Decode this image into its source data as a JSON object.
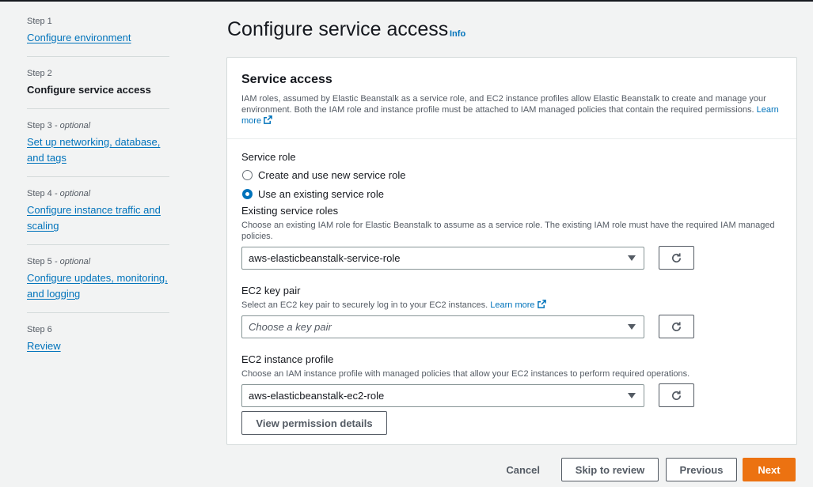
{
  "sidebar": {
    "steps": [
      {
        "num": "Step 1",
        "optional": "",
        "title": "Configure environment"
      },
      {
        "num": "Step 2",
        "optional": "",
        "title": "Configure service access"
      },
      {
        "num": "Step 3",
        "optional": " - optional",
        "title_lines": [
          "Set up networking, database,",
          "and tags"
        ]
      },
      {
        "num": "Step 4",
        "optional": " - optional",
        "title_lines": [
          "Configure instance traffic and",
          "scaling"
        ]
      },
      {
        "num": "Step 5",
        "optional": " - optional",
        "title_lines": [
          "Configure updates, monitoring,",
          "and logging"
        ]
      },
      {
        "num": "Step 6",
        "optional": "",
        "title": "Review"
      }
    ]
  },
  "header": {
    "title": "Configure service access",
    "info": "Info"
  },
  "panel": {
    "title": "Service access",
    "desc": "IAM roles, assumed by Elastic Beanstalk as a service role, and EC2 instance profiles allow Elastic Beanstalk to create and manage your environment. Both the IAM role and instance profile must be attached to IAM managed policies that contain the required permissions. ",
    "desc_link": "Learn more"
  },
  "service_role": {
    "label": "Service role",
    "option_new": "Create and use new service role",
    "option_existing": "Use an existing service role"
  },
  "existing_roles": {
    "label": "Existing service roles",
    "desc": "Choose an existing IAM role for Elastic Beanstalk to assume as a service role. The existing IAM role must have the required IAM managed policies.",
    "value": "aws-elasticbeanstalk-service-role"
  },
  "key_pair": {
    "label": "EC2 key pair",
    "desc": "Select an EC2 key pair to securely log in to your EC2 instances. ",
    "desc_link": "Learn more",
    "placeholder": "Choose a key pair"
  },
  "instance_profile": {
    "label": "EC2 instance profile",
    "desc": "Choose an IAM instance profile with managed policies that allow your EC2 instances to perform required operations.",
    "value": "aws-elasticbeanstalk-ec2-role"
  },
  "view_permissions": "View permission details",
  "footer": {
    "cancel": "Cancel",
    "skip": "Skip to review",
    "previous": "Previous",
    "next": "Next"
  },
  "colors": {
    "accent": "#0073bb",
    "primary": "#ec7211",
    "background": "#f2f3f3"
  }
}
